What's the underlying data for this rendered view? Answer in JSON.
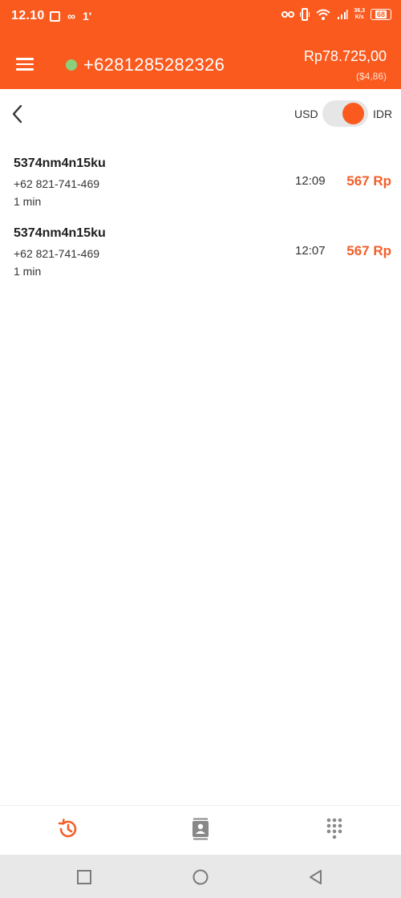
{
  "status_bar": {
    "time": "12.10",
    "glyph_1": "∞",
    "glyph_2": "1'",
    "net_speed_top": "36,3",
    "net_speed_bottom": "K/s",
    "battery": "68"
  },
  "header": {
    "phone_number": "+6281285282326",
    "balance": "Rp78.725,00",
    "balance_usd": "($4,86)",
    "online_color": "#8bcf7d",
    "accent_color": "#fb5a1e"
  },
  "subbar": {
    "currency_left": "USD",
    "currency_right": "IDR",
    "selected_currency": "IDR"
  },
  "calls": [
    {
      "name": "5374nm4n15ku",
      "number": "+62 821-741-469",
      "duration": "1 min",
      "time": "12:09",
      "cost": "567 Rp"
    },
    {
      "name": "5374nm4n15ku",
      "number": "+62 821-741-469",
      "duration": "1 min",
      "time": "12:07",
      "cost": "567 Rp"
    }
  ],
  "bottom_nav": {
    "items": [
      {
        "icon": "history-icon",
        "active": true
      },
      {
        "icon": "contacts-icon",
        "active": false
      },
      {
        "icon": "dialpad-icon",
        "active": false
      }
    ]
  },
  "system_nav": {
    "icons": [
      "recents-square-icon",
      "home-circle-icon",
      "back-triangle-icon"
    ]
  }
}
